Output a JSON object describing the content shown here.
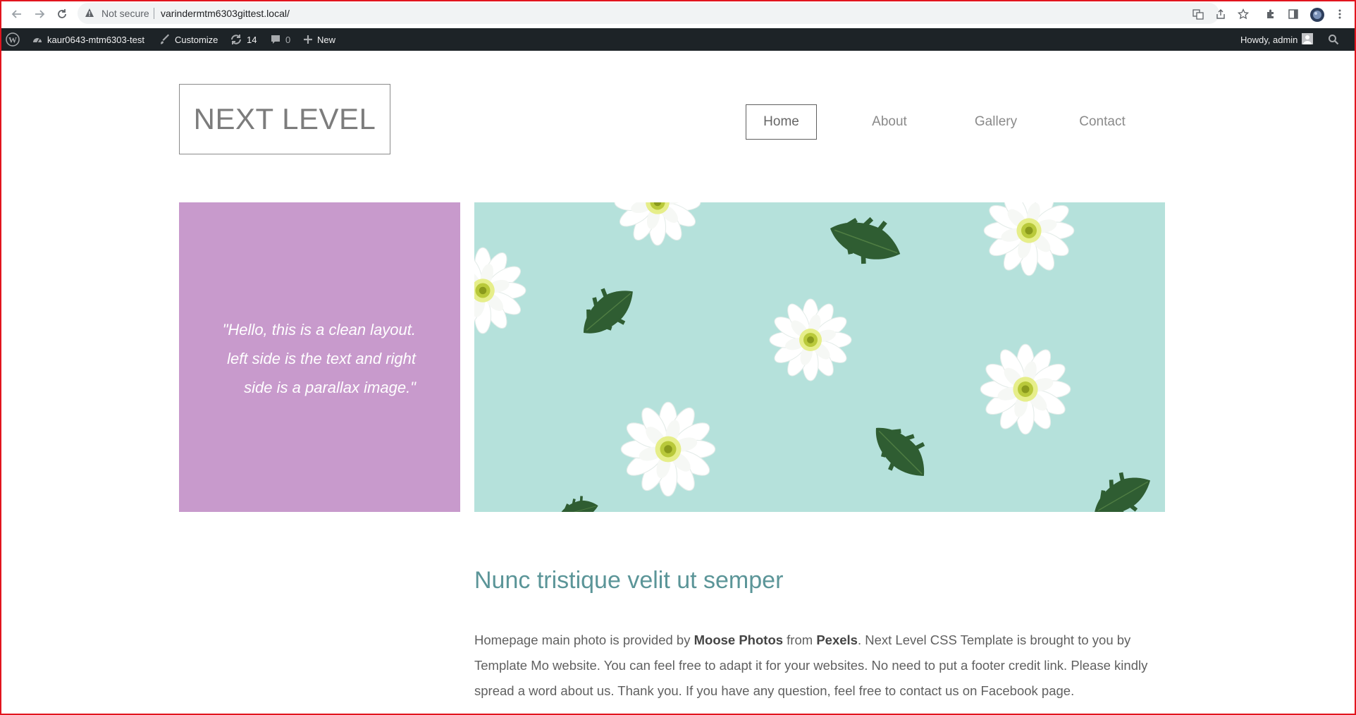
{
  "browser": {
    "security_label": "Not secure",
    "url": "varindermtm6303gittest.local/"
  },
  "admin_bar": {
    "site_name": "kaur0643-mtm6303-test",
    "customize": "Customize",
    "updates_count": "14",
    "comments_count": "0",
    "new_label": "New",
    "greeting": "Howdy, admin"
  },
  "site": {
    "logo": "NEXT LEVEL",
    "nav": [
      "Home",
      "About",
      "Gallery",
      "Contact"
    ]
  },
  "hero": {
    "quote_lines": [
      "\"Hello, this is a clean layout.",
      "left side is the text and right",
      "side is a parallax image.\""
    ],
    "image_bg": "#b5e1db",
    "quote_bg": "#c89acc"
  },
  "content": {
    "heading": "Nunc tristique velit ut semper",
    "para_1": "Homepage main photo is provided by ",
    "credit_photographer": "Moose Photos",
    "para_2": " from ",
    "credit_site": "Pexels",
    "para_3": ". Next Level CSS Template is brought to you by Template Mo website. You can feel free to adapt it for your websites. No need to put a footer credit link. Please kindly spread a word about us. Thank you. If you have any question, feel free to contact us on Facebook page."
  }
}
